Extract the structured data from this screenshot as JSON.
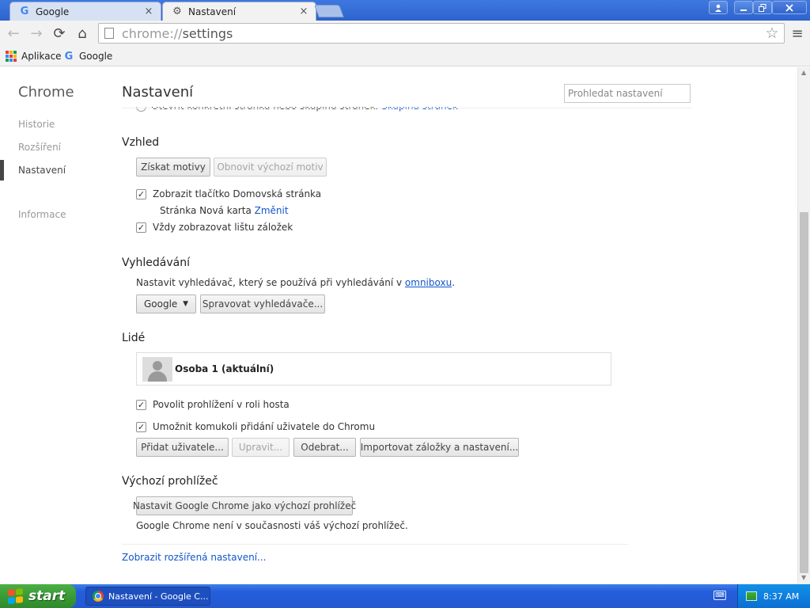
{
  "tabs": [
    {
      "label": "Google",
      "favicon": "google-g-icon",
      "close": "×"
    },
    {
      "label": "Nastavení",
      "favicon": "gear-icon",
      "close": "×"
    }
  ],
  "toolbar": {
    "back": "←",
    "forward": "→",
    "reload": "⟳",
    "home": "⌂",
    "url_scheme": "chrome://",
    "url_path": "settings",
    "star": "☆",
    "menu": "≡"
  },
  "bookmarks": [
    {
      "label": "Aplikace",
      "icon": "apps-grid-icon"
    },
    {
      "label": "Google",
      "icon": "google-g-icon"
    }
  ],
  "sidebar": {
    "title": "Chrome",
    "items": [
      {
        "label": "Historie"
      },
      {
        "label": "Rozšíření"
      },
      {
        "label": "Nastavení",
        "active": true
      },
      {
        "label": "Informace"
      }
    ]
  },
  "header": {
    "title": "Nastavení",
    "search_placeholder": "Prohledat nastavení"
  },
  "cut_row": {
    "text": "Otevřít konkrétní stránku nebo skupinu stránek.",
    "link": "Skupina stránek"
  },
  "appearance": {
    "title": "Vzhled",
    "get_themes": "Získat motivy",
    "reset_theme": "Obnovit výchozí motiv",
    "show_home_button": "Zobrazit tlačítko Domovská stránka",
    "home_page_text": "Stránka Nová karta",
    "home_page_change": "Změnit",
    "show_bookmarks_bar": "Vždy zobrazovat lištu záložek"
  },
  "search": {
    "title": "Vyhledávání",
    "description": "Nastavit vyhledávač, který se používá při vyhledávání v",
    "omnibox_link": "omniboxu",
    "period": ".",
    "engine_selected": "Google",
    "manage_button": "Spravovat vyhledávače..."
  },
  "people": {
    "title": "Lidé",
    "profile_name": "Osoba 1 (aktuální)",
    "guest_browsing": "Povolit prohlížení v roli hosta",
    "anyone_add": "Umožnit komukoli přidání uživatele do Chromu",
    "add_user": "Přidat uživatele...",
    "edit": "Upravit...",
    "remove": "Odebrat...",
    "import": "Importovat záložky a nastavení..."
  },
  "default_browser": {
    "title": "Výchozí prohlížeč",
    "button": "Nastavit Google Chrome jako výchozí prohlížeč",
    "status": "Google Chrome není v současnosti váš výchozí prohlížeč."
  },
  "advanced_link": "Zobrazit rozšířená nastavení...",
  "taskbar": {
    "start": "start",
    "window_title": "Nastavení - Google C...",
    "time": "8:37 AM"
  },
  "colors": {
    "link": "#1155cc",
    "titlebar": "#2e63cd",
    "start_green": "#3a9a35",
    "taskbar_blue": "#245edb"
  }
}
